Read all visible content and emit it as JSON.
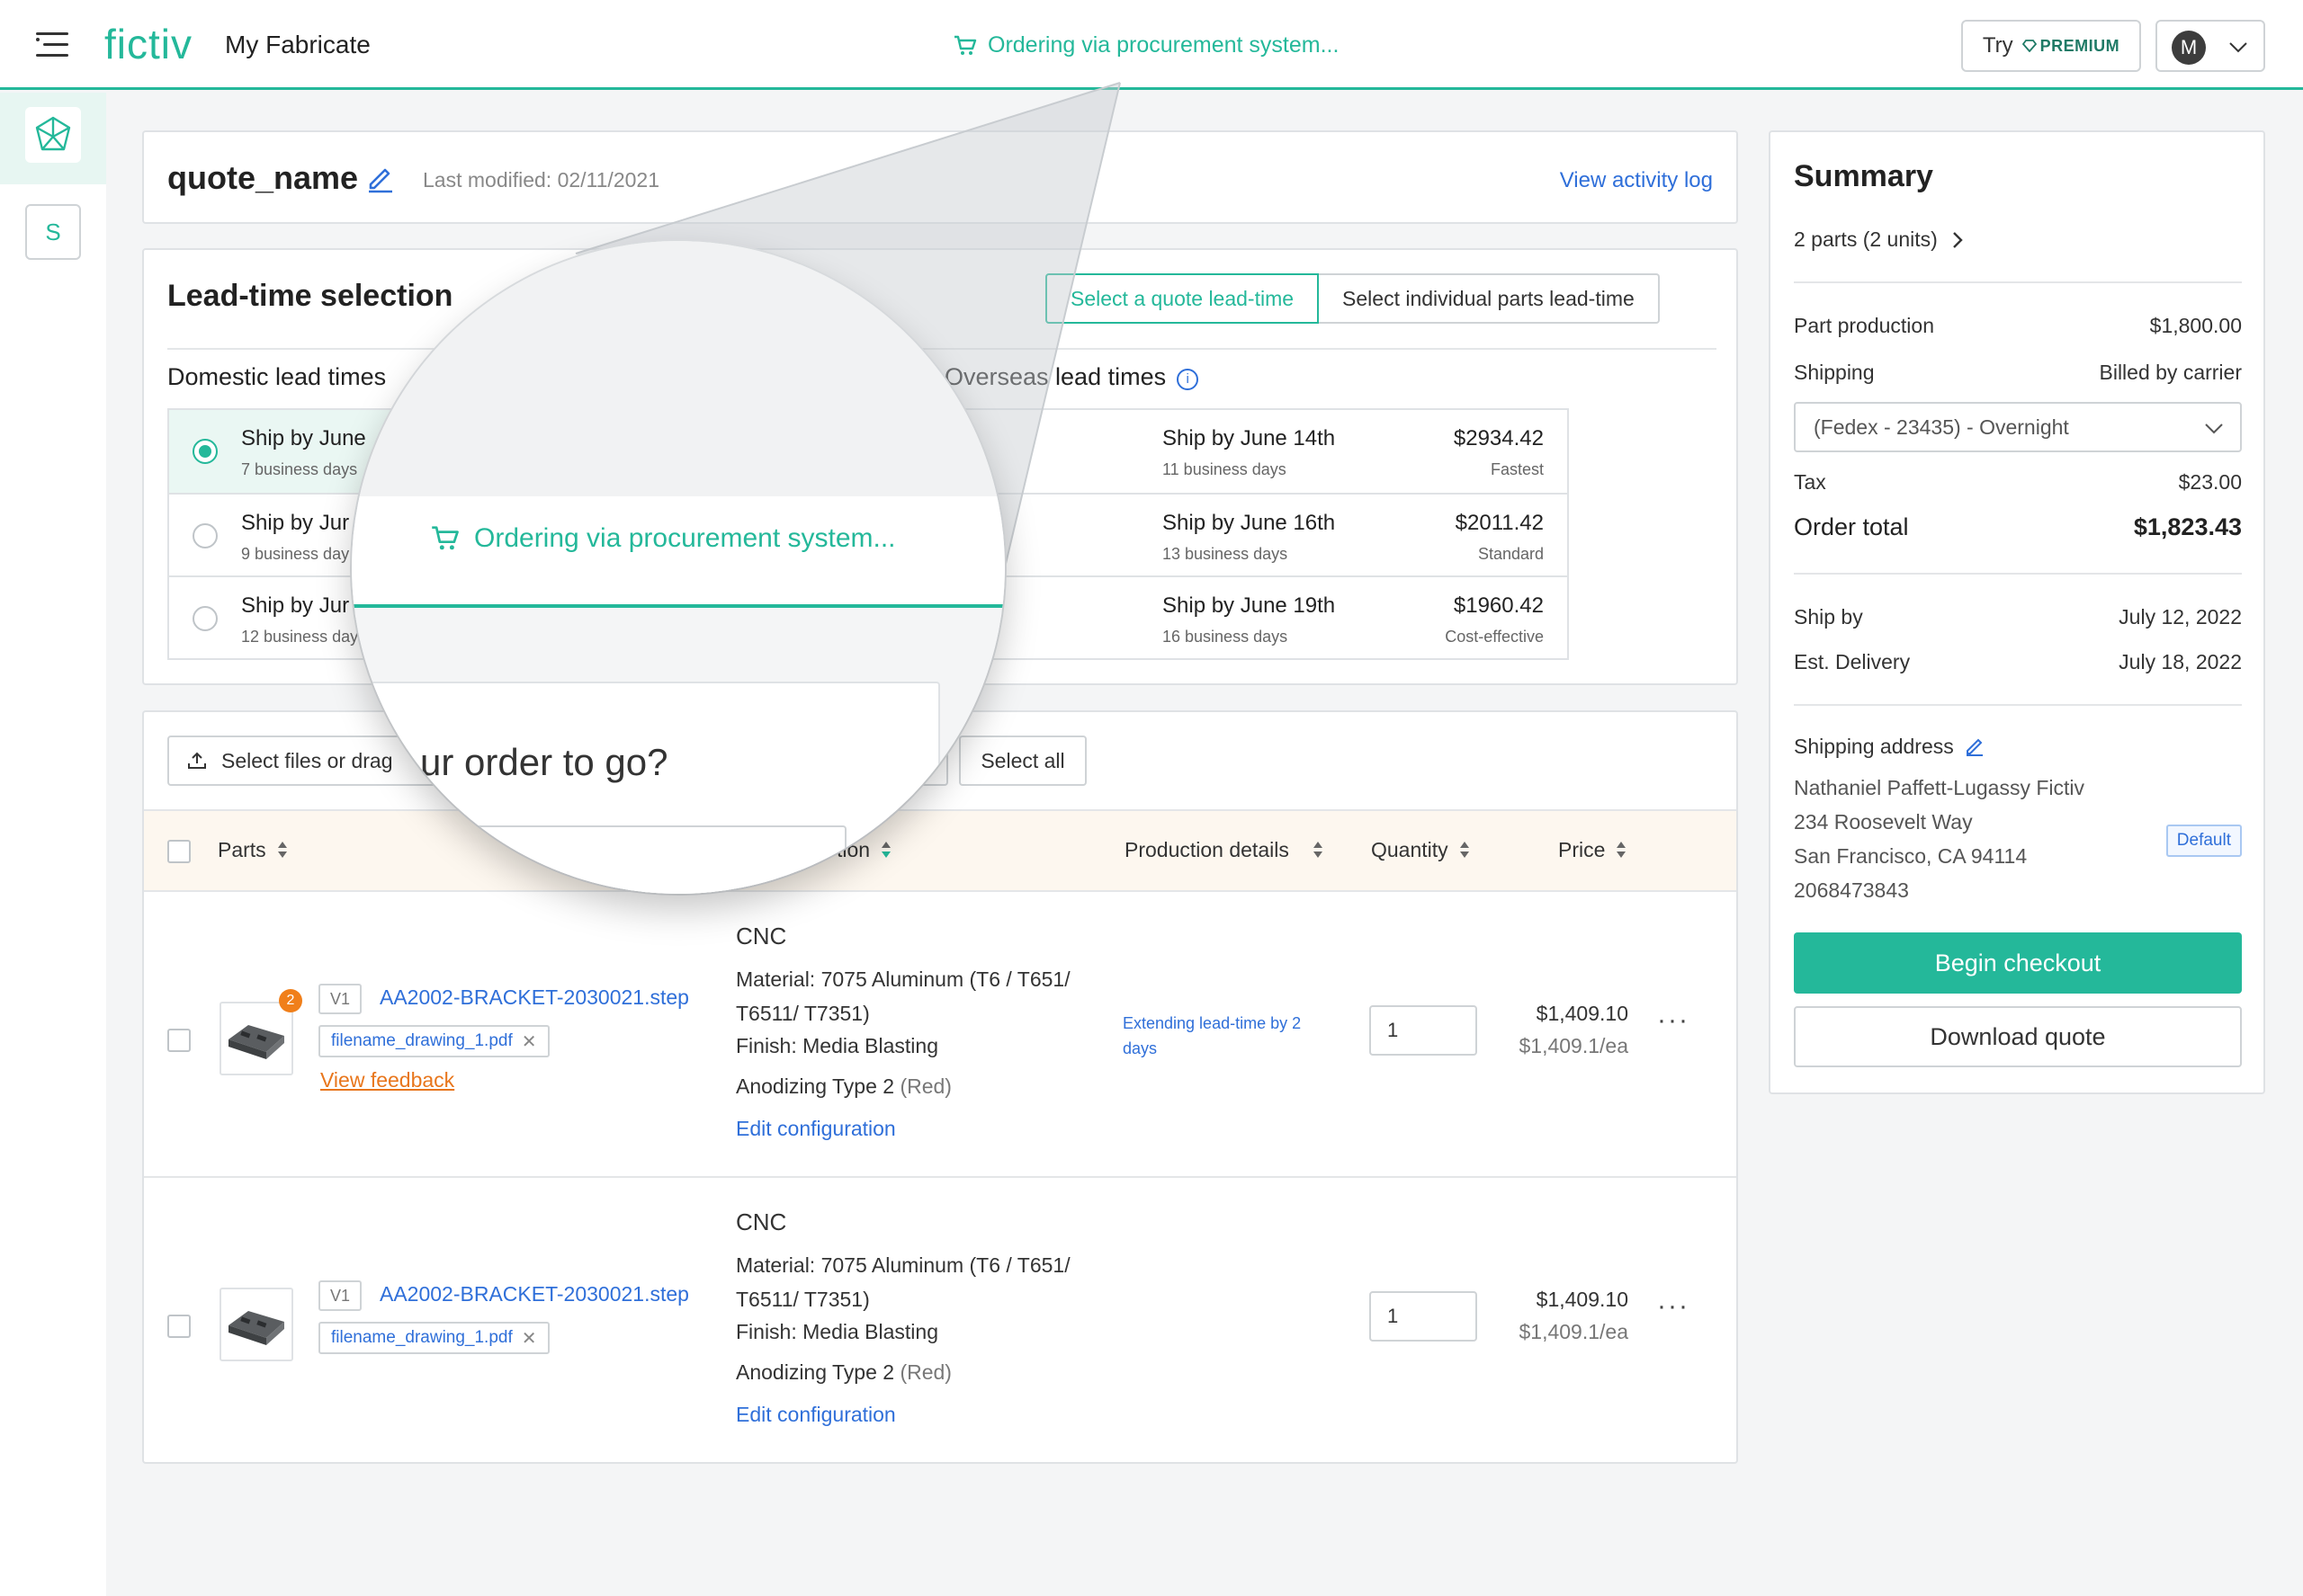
{
  "topbar": {
    "logo": "fictiv",
    "app_title": "My Fabricate",
    "status": "Ordering via procurement system...",
    "try_label": "Try",
    "premium_label": "PREMIUM",
    "avatar_initial": "M"
  },
  "sidenav": {
    "item_s": "S"
  },
  "quote": {
    "name": "quote_name",
    "last_modified": "Last modified: 02/11/2021",
    "activity_link": "View activity log"
  },
  "lead_time": {
    "title": "Lead-time selection",
    "mode_quote": "Select a quote lead-time",
    "mode_parts": "Select individual parts lead-time",
    "domestic_heading": "Domestic lead times",
    "overseas_heading": "Overseas lead times",
    "domestic": [
      {
        "name": "Ship by June",
        "sub": "7 business days",
        "selected": true
      },
      {
        "name": "Ship by Jur",
        "sub": "9 business day",
        "selected": false
      },
      {
        "name": "Ship by Jur",
        "sub": "12 business day",
        "selected": false
      }
    ],
    "overseas": [
      {
        "name": "Ship by June 14th",
        "sub": "11 business days",
        "price": "$2934.42",
        "tag": "Fastest"
      },
      {
        "name": "Ship by June 16th",
        "sub": "13 business days",
        "price": "$2011.42",
        "tag": "Standard"
      },
      {
        "name": "Ship by June 19th",
        "sub": "16 business days",
        "price": "$1960.42",
        "tag": "Cost-effective"
      }
    ]
  },
  "parts": {
    "upload_label": "Select files or drag",
    "select_all": "Select all",
    "headers": {
      "parts": "Parts",
      "config": "tion",
      "production": "Production details",
      "quantity": "Quantity",
      "price": "Price"
    },
    "rows": [
      {
        "badge": "2",
        "version": "V1",
        "file": "AA2002-BRACKET-2030021.step",
        "drawing": "filename_drawing_1.pdf",
        "feedback": "View feedback",
        "process": "CNC",
        "material": "Material: 7075 Aluminum (T6 / T651/ T6511/ T7351)",
        "finish": "Finish: Media Blasting",
        "anodizing": "Anodizing Type 2",
        "anodizing_color": "(Red)",
        "edit": "Edit configuration",
        "note": "Extending lead-time by 2 days",
        "quantity": "1",
        "price": "$1,409.10",
        "price_each": "$1,409.1/ea"
      },
      {
        "badge": "",
        "version": "V1",
        "file": "AA2002-BRACKET-2030021.step",
        "drawing": "filename_drawing_1.pdf",
        "feedback": "",
        "process": "CNC",
        "material": "Material: 7075 Aluminum (T6 / T651/ T6511/ T7351)",
        "finish": "Finish: Media Blasting",
        "anodizing": "Anodizing Type 2",
        "anodizing_color": "(Red)",
        "edit": "Edit configuration",
        "note": "",
        "quantity": "1",
        "price": "$1,409.10",
        "price_each": "$1,409.1/ea"
      }
    ]
  },
  "summary": {
    "title": "Summary",
    "parts_count": "2 parts (2 units)",
    "part_production_label": "Part production",
    "part_production_value": "$1,800.00",
    "shipping_label": "Shipping",
    "shipping_value": "Billed by carrier",
    "shipping_method": "(Fedex - 23435) - Overnight",
    "tax_label": "Tax",
    "tax_value": "$23.00",
    "total_label": "Order total",
    "total_value": "$1,823.43",
    "ship_by_label": "Ship by",
    "ship_by_value": "July 12, 2022",
    "delivery_label": "Est. Delivery",
    "delivery_value": "July 18, 2022",
    "address_label": "Shipping address",
    "address_lines": [
      "Nathaniel Paffett-Lugassy Fictiv",
      "234 Roosevelt Way",
      "San Francisco, CA 94114",
      "2068473843"
    ],
    "default_label": "Default",
    "checkout": "Begin checkout",
    "download": "Download quote"
  },
  "magnifier": {
    "status": "Ordering via procurement system...",
    "question": "ur order to go?"
  },
  "colors": {
    "accent": "#24b89a",
    "link": "#2f6fd9",
    "warning": "#e8761c"
  }
}
